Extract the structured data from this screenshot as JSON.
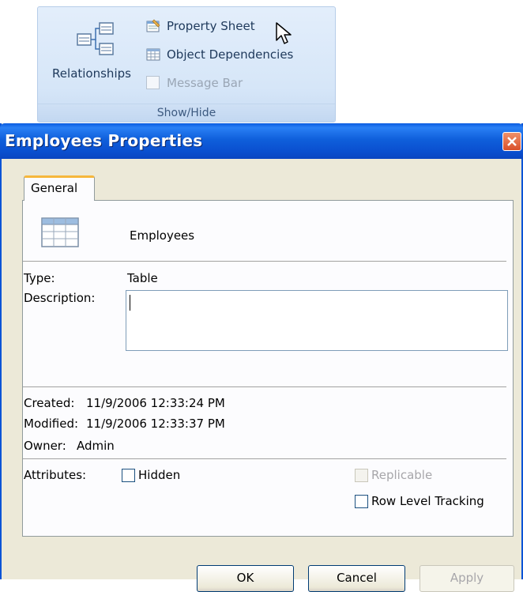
{
  "ribbon": {
    "relationships_label": "Relationships",
    "property_sheet_label": "Property Sheet",
    "object_dependencies_label": "Object Dependencies",
    "message_bar_label": "Message Bar",
    "group_label": "Show/Hide"
  },
  "dialog": {
    "title": "Employees Properties",
    "tab_general": "General",
    "object_name": "Employees",
    "type_label": "Type:",
    "type_value": "Table",
    "description_label": "Description:",
    "description_value": "",
    "created_label": "Created:",
    "created_value": "11/9/2006 12:33:24 PM",
    "modified_label": "Modified:",
    "modified_value": "11/9/2006 12:33:37 PM",
    "owner_label": "Owner:",
    "owner_value": "Admin",
    "attributes_label": "Attributes:",
    "hidden_label": "Hidden",
    "replicable_label": "Replicable",
    "row_level_tracking_label": "Row Level Tracking",
    "ok_label": "OK",
    "cancel_label": "Cancel",
    "apply_label": "Apply"
  },
  "icons": [
    "relationships-icon",
    "property-sheet-icon",
    "object-dependencies-icon",
    "mouse-cursor-icon",
    "close-icon",
    "table-icon"
  ],
  "colors": {
    "titlebar": "#0a54d6",
    "dialog_bg": "#ece9d8",
    "ribbon_bg": "#d6e6f8",
    "tab_accent": "#f6b73c",
    "close_button": "#d9502a"
  }
}
